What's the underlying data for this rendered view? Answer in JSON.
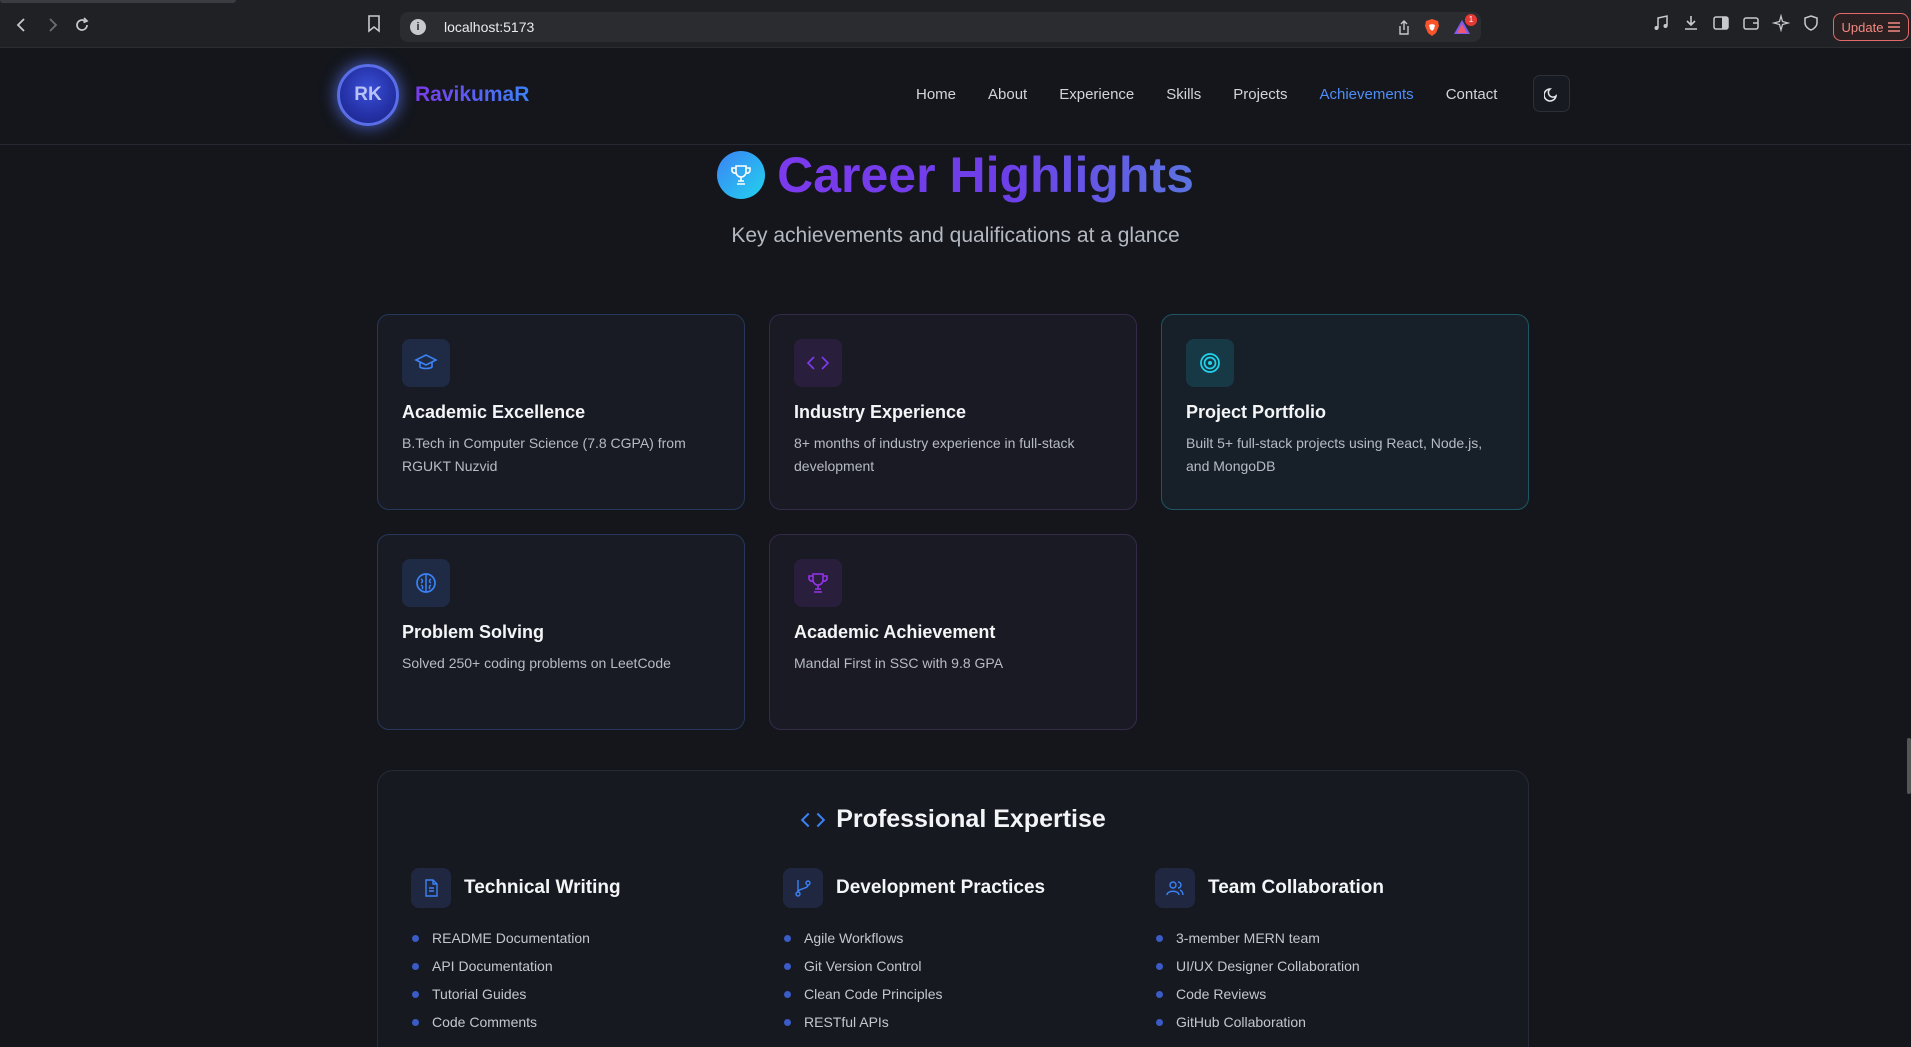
{
  "browser": {
    "url": "localhost:5173",
    "alert_count": "1",
    "update_label": "Update"
  },
  "site": {
    "logo_initials": "RK",
    "logo_name": "RavikumaR",
    "nav": [
      "Home",
      "About",
      "Experience",
      "Skills",
      "Projects",
      "Achievements",
      "Contact"
    ],
    "active_nav": "Achievements"
  },
  "hero": {
    "title": "Career Highlights",
    "subtitle": "Key achievements and qualifications at a glance"
  },
  "cards": [
    {
      "icon": "graduation-cap-icon",
      "title": "Academic Excellence",
      "description": "B.Tech in Computer Science (7.8 CGPA) from RGUKT Nuzvid",
      "accent": "#3b82f6"
    },
    {
      "icon": "code-icon",
      "title": "Industry Experience",
      "description": "8+ months of industry experience in full-stack development",
      "accent": "#7c3aed"
    },
    {
      "icon": "target-icon",
      "title": "Project Portfolio",
      "description": "Built 5+ full-stack projects using React, Node.js, and MongoDB",
      "accent": "#22d3ee"
    },
    {
      "icon": "brain-icon",
      "title": "Problem Solving",
      "description": "Solved 250+ coding problems on LeetCode",
      "accent": "#3b82f6"
    },
    {
      "icon": "trophy-icon",
      "title": "Academic Achievement",
      "description": "Mandal First in SSC with 9.8 GPA",
      "accent": "#9333ea"
    }
  ],
  "expertise": {
    "title": "Professional Expertise",
    "columns": [
      {
        "icon": "document-icon",
        "title": "Technical Writing",
        "items": [
          "README Documentation",
          "API Documentation",
          "Tutorial Guides",
          "Code Comments"
        ]
      },
      {
        "icon": "git-branch-icon",
        "title": "Development Practices",
        "items": [
          "Agile Workflows",
          "Git Version Control",
          "Clean Code Principles",
          "RESTful APIs"
        ]
      },
      {
        "icon": "users-icon",
        "title": "Team Collaboration",
        "items": [
          "3-member MERN team",
          "UI/UX Designer Collaboration",
          "Code Reviews",
          "GitHub Collaboration"
        ]
      }
    ]
  },
  "colors": {
    "background": "#14161c",
    "accent_blue": "#4f8df7",
    "accent_purple": "#7c3aed",
    "accent_cyan": "#22d3ee"
  }
}
